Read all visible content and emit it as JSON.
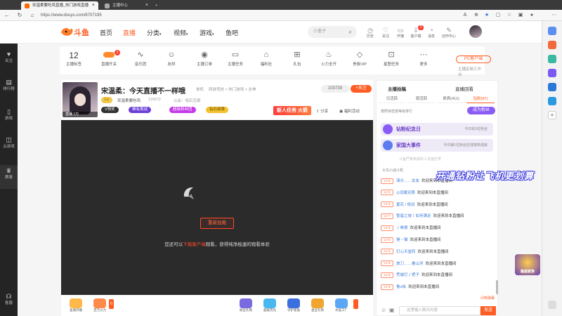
{
  "browser": {
    "tabs": [
      {
        "label": "宋温柔要吃鸡直播_热门游戏直播",
        "active": true
      },
      {
        "label": "主播中心",
        "active": false
      }
    ],
    "new_tab": "+",
    "url": "https://www.douyu.com/6707195"
  },
  "header": {
    "logo": "斗鱼",
    "nav": [
      "首页",
      "直播",
      "分类",
      "视频",
      "游戏",
      "鱼吧"
    ],
    "active_nav": "直播",
    "search_placeholder": "小盒子",
    "icons": [
      {
        "label": "历史",
        "icon": "clock-icon"
      },
      {
        "label": "关注",
        "icon": "heart-icon"
      },
      {
        "label": "开播",
        "icon": "video-icon"
      },
      {
        "label": "客户端",
        "icon": "download-icon"
      },
      {
        "label": "消息",
        "icon": "bell-icon"
      },
      {
        "label": "创作中心",
        "icon": "edit-icon"
      }
    ],
    "message_badge": "2"
  },
  "leftbar": {
    "items": [
      "关注",
      "排行榜",
      "游戏",
      "云游戏",
      "赛事",
      "客服"
    ]
  },
  "categories": {
    "count": "12",
    "count_label": "主播标签",
    "items": [
      "直播开关",
      "音乐团",
      "友邦",
      "主播订单",
      "主播任务",
      "福利社",
      "礼包",
      "火力全开",
      "贵族VIP",
      "星图任务",
      "更多"
    ],
    "badge": "3",
    "pc_button": "PC客户端",
    "pc_sub": "主播定制工作台"
  },
  "streamer": {
    "title": "宋温柔：今天直播不一样哦",
    "category": "单机",
    "path": "网游竞技 > 热门游戏 > 女神",
    "name": "宋温柔要吃鸡",
    "hot": "116672",
    "fans_label": "公会：哈石互娱",
    "badges": [
      "V领奖",
      "稀有挑战",
      "超级粉丝团",
      "钻石勋章"
    ],
    "follow_count": "103739",
    "follow_label": "关注",
    "new_task": "新人任务 火箭",
    "share": "分享",
    "report": "福利活动",
    "avatar_tag": "直播 1万"
  },
  "player": {
    "reload": "重新加载",
    "hint_prefix": "您还可以",
    "hint_link": "下载客户端",
    "hint_suffix": "观看，获得纯净极速的观看体验"
  },
  "giftbar": {
    "left": [
      "鱼塘开播",
      "百万火力"
    ],
    "right": [
      "粉丝礼物",
      "超级荧光",
      "守护星辰",
      "金豆礼物",
      "水晶工厂"
    ],
    "more_badge": "0"
  },
  "chat": {
    "tabs": [
      "主播捡稿",
      "直播回看"
    ],
    "subtabs": [
      "日活跃",
      "周活跃",
      "贵宾(411)",
      "钻粉(87)"
    ],
    "rank_label": "按照亲密度等级排行",
    "fan_button": "成为粉丝",
    "promos": [
      {
        "title": "钻粉纪念日",
        "sub": "今日有3位粉丝"
      },
      {
        "title": "家国大事件",
        "sub": "今日第1位粉丝达成榜单成就"
      }
    ],
    "notice": "斗鱼严禁未成年人充值打赏",
    "system_line": "大鸟小战斗机",
    "messages": [
      {
        "level": "LV 6",
        "name": "清分……女友",
        "text": "欢迎来到本直播间"
      },
      {
        "level": "LV 6",
        "name": "◎没耀无限",
        "text": "欢迎来到本直播间"
      },
      {
        "level": "LV 6",
        "name": "夏花 / 依旧",
        "text": "欢迎来到本直播间"
      },
      {
        "level": "LV 7",
        "name": "暂留之坡丨如何满足",
        "text": "欢迎来到本直播间"
      },
      {
        "level": "LV 6",
        "name": "丿希狼",
        "text": "欢迎来到本直播间"
      },
      {
        "level": "LV 6",
        "name": "锤丶猫",
        "text": "欢迎来到本直播间"
      },
      {
        "level": "LV 6",
        "name": "钉心天堂药",
        "text": "欢迎来到本直播间"
      },
      {
        "level": "LV 6",
        "name": "旅刀……看山河",
        "text": "欢迎来到本直播间"
      },
      {
        "level": "LV 6",
        "name": "荒城打丿把子",
        "text": "欢迎来到本直播间"
      },
      {
        "level": "LV 6",
        "name": "鲁o佑",
        "text": "欢迎来到本直播间"
      }
    ],
    "input_placeholder": "这里输入聊天内容",
    "send": "发送",
    "flash": "闪电弹幕"
  },
  "overlay": {
    "text": "开通钻粉让飞机更划算",
    "badge": "魅惑家族"
  },
  "colors": {
    "accent": "#ff5d23",
    "purple": "#8a5cf5",
    "player_bg": "#2b2b2b"
  }
}
